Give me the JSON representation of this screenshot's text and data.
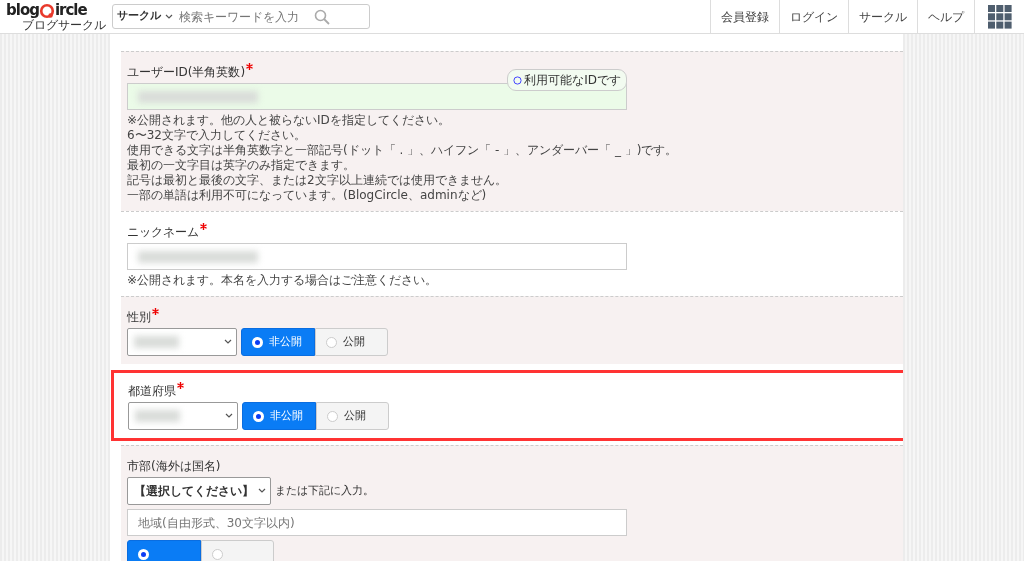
{
  "header": {
    "logo": {
      "left": "blog",
      "right": "ircle",
      "sub": "ブログサークル"
    },
    "search": {
      "category": "サークル",
      "placeholder": "検索キーワードを入力"
    },
    "nav": [
      "会員登録",
      "ログイン",
      "サークル",
      "ヘルプ"
    ]
  },
  "sections": [
    {
      "kind": "text",
      "label": "ユーザーID(半角英数)",
      "required": true,
      "shaded": true,
      "valid": true,
      "badge": "利用可能なIDです",
      "notes": [
        "※公開されます。他の人と被らないIDを指定してください。",
        "6〜32文字で入力してください。",
        "使用できる文字は半角英数字と一部記号(ドット「 . 」、ハイフン「 - 」、アンダーバー「 _ 」)です。",
        "最初の一文字目は英字のみ指定できます。",
        "記号は最初と最後の文字、または2文字以上連続では使用できません。",
        "一部の単語は利用不可になっています。(BlogCircle、adminなど)"
      ]
    },
    {
      "kind": "text",
      "label": "ニックネーム",
      "required": true,
      "shaded": false,
      "valid": false,
      "notes": [
        "※公開されます。本名を入力する場合はご注意ください。"
      ]
    },
    {
      "kind": "select",
      "label": "性別",
      "required": true,
      "shaded": true,
      "highlighted": false,
      "privacy": [
        {
          "label": "非公開",
          "selected": true
        },
        {
          "label": "公開",
          "selected": false
        }
      ]
    },
    {
      "kind": "select",
      "label": "都道府県",
      "required": true,
      "shaded": false,
      "highlighted": true,
      "privacy": [
        {
          "label": "非公開",
          "selected": true
        },
        {
          "label": "公開",
          "selected": false
        }
      ]
    },
    {
      "kind": "city",
      "label": "市部(海外は国名)",
      "required": false,
      "shaded": true,
      "select": "【選択してください】",
      "hint": "または下記に入力。",
      "placeholder": "地域(自由形式、30文字以内)",
      "privacy": [
        {
          "selected": true
        },
        {
          "selected": false
        }
      ]
    }
  ]
}
